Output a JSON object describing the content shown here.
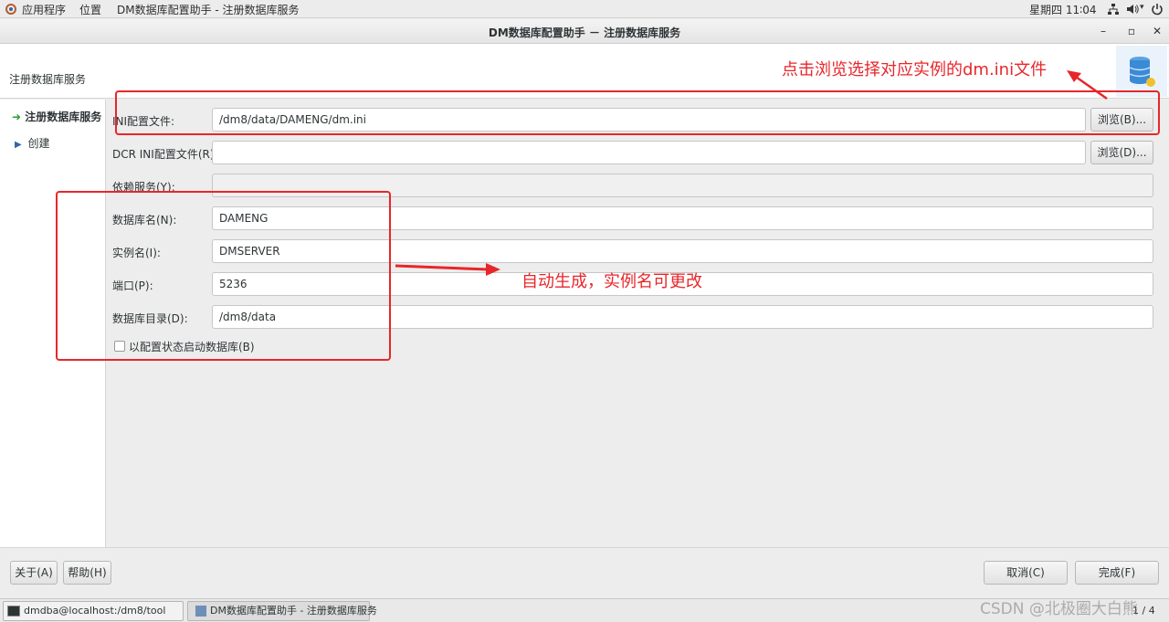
{
  "topbar": {
    "apps_label": "应用程序",
    "places_label": "位置",
    "active_window": "DM数据库配置助手 - 注册数据库服务",
    "clock": "星期四 11∶04"
  },
  "window": {
    "title": "DM数据库配置助手 － 注册数据库服务",
    "minimize": "–",
    "maximize": "▫",
    "close": "✕"
  },
  "header": {
    "title": "注册数据库服务"
  },
  "sidebar": {
    "items": [
      {
        "label": "注册数据库服务",
        "active": true
      },
      {
        "label": "创建",
        "active": false
      }
    ]
  },
  "form": {
    "ini_label": "INI配置文件:",
    "ini_value": "/dm8/data/DAMENG/dm.ini",
    "ini_browse": "浏览(B)...",
    "dcr_label": "DCR INI配置文件(R):",
    "dcr_value": "",
    "dcr_browse": "浏览(D)...",
    "depend_label": "依赖服务(Y):",
    "depend_value": "",
    "dbname_label": "数据库名(N):",
    "dbname_value": "DAMENG",
    "instance_label": "实例名(I):",
    "instance_value": "DMSERVER",
    "port_label": "端口(P):",
    "port_value": "5236",
    "dir_label": "数据库目录(D):",
    "dir_value": "/dm8/data",
    "config_start_label": "以配置状态启动数据库(B)",
    "config_start_checked": false
  },
  "footer": {
    "about": "关于(A)",
    "help": "帮助(H)",
    "cancel": "取消(C)",
    "finish": "完成(F)"
  },
  "annotations": {
    "browse_note": "点击浏览选择对应实例的dm.ini文件",
    "auto_note": "自动生成，实例名可更改"
  },
  "taskbar": {
    "terminal": "dmdba@localhost:/dm8/tool",
    "app": "DM数据库配置助手 - 注册数据库服务",
    "pager": "1 / 4",
    "watermark": "CSDN @北极圈大白熊"
  },
  "colors": {
    "annotation_red": "#e8262a",
    "active_arrow": "#2a9d3a",
    "bullet_blue": "#3465a4"
  }
}
